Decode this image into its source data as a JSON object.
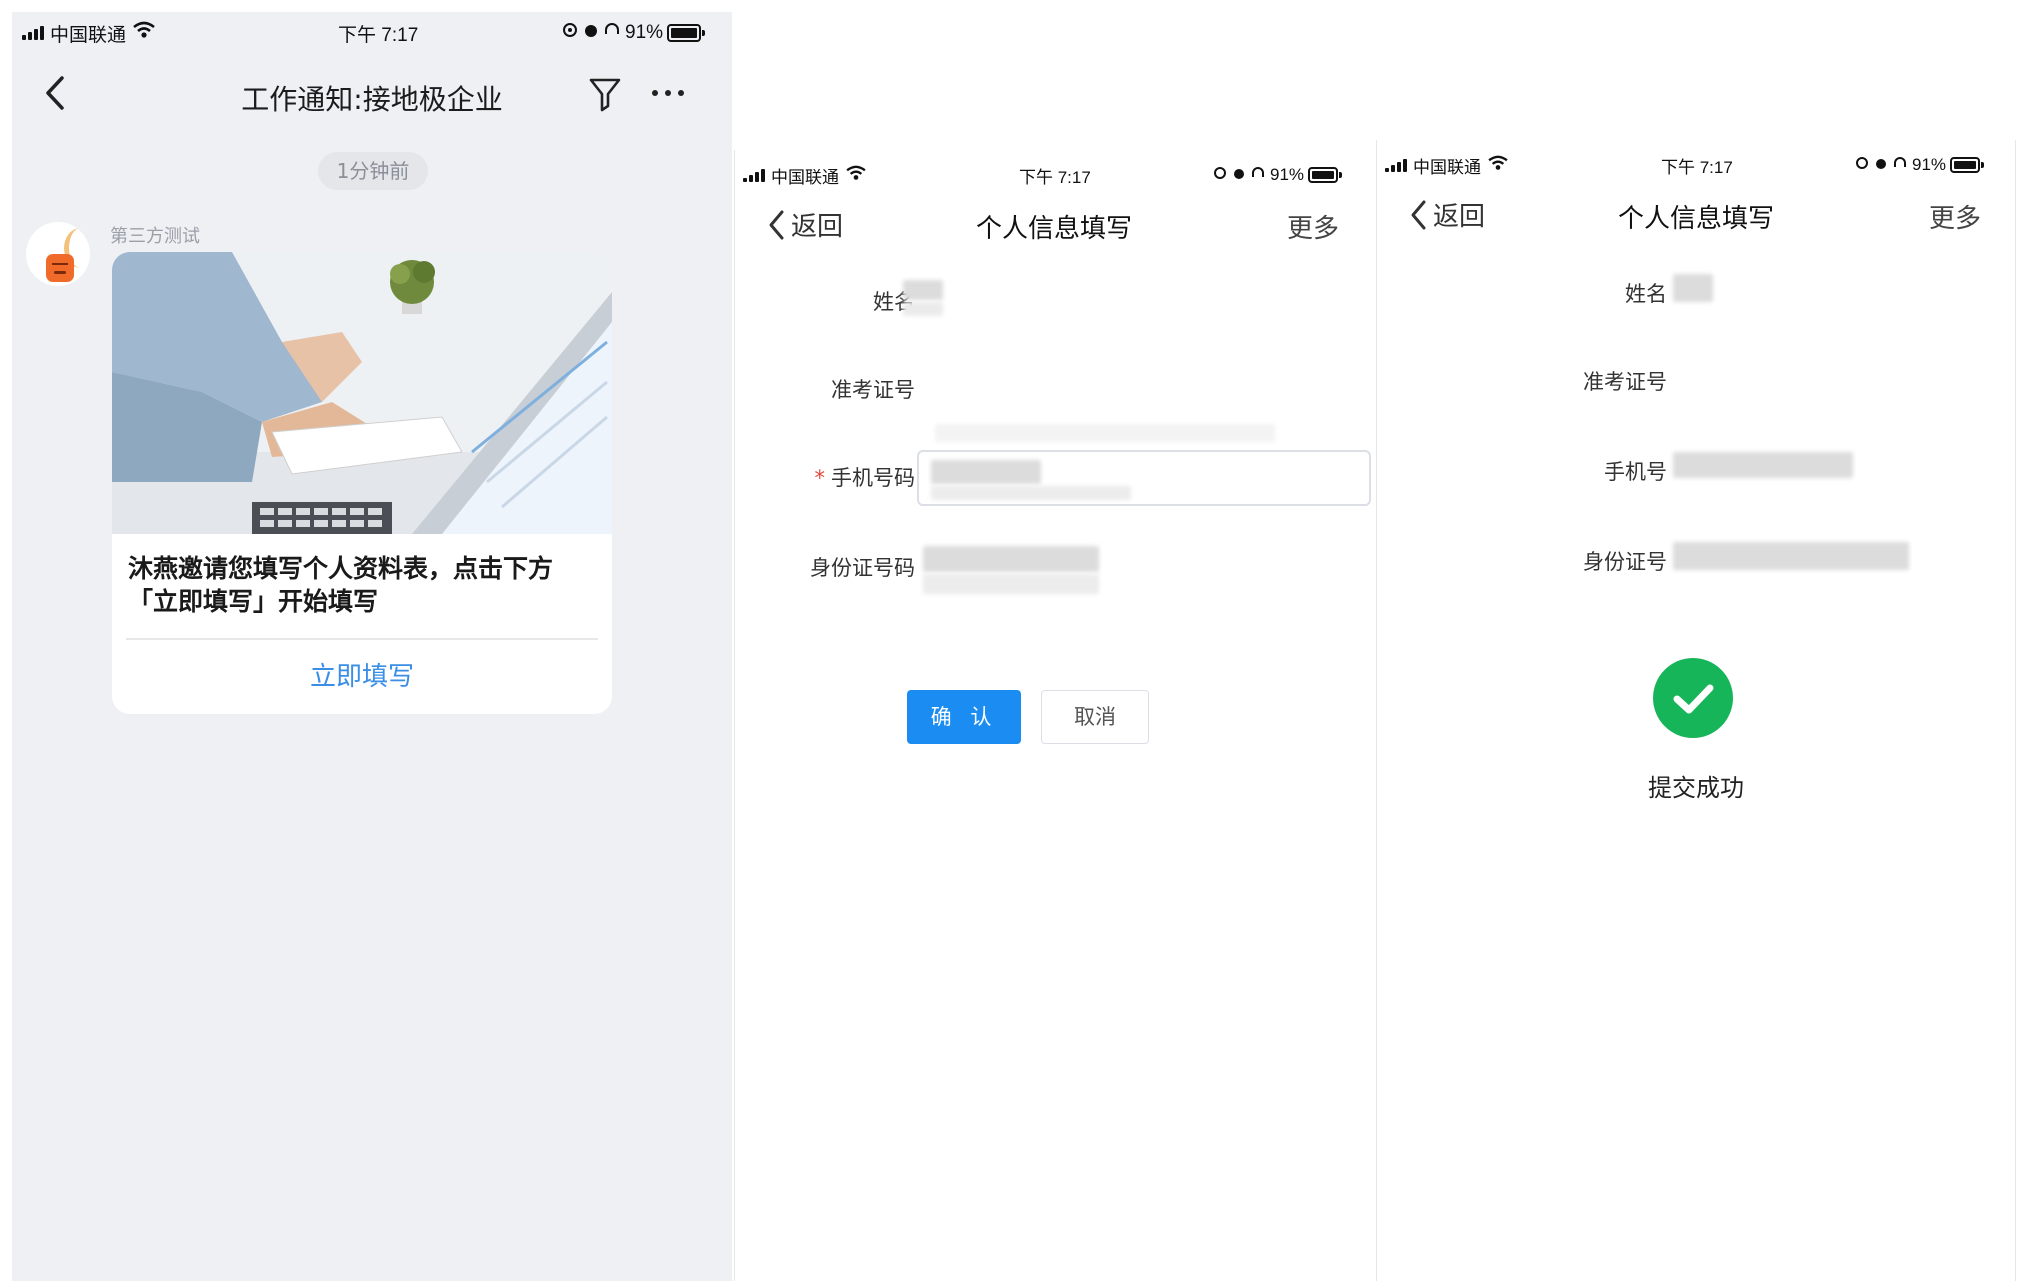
{
  "chat": {
    "status": {
      "carrier": "中国联通",
      "time": "下午 7:17",
      "battery": "91%"
    },
    "title": "工作通知:接地极企业",
    "time_pill": "1分钟前",
    "sender": "第三方测试",
    "card_text": "沐燕邀请您填写个人资料表，点击下方「立即填写」开始填写",
    "card_button": "立即填写"
  },
  "form": {
    "status": {
      "carrier": "中国联通",
      "time": "下午 7:17",
      "battery": "91%"
    },
    "back": "返回",
    "title": "个人信息填写",
    "more": "更多",
    "fields": [
      {
        "label": "姓名"
      },
      {
        "label": "准考证号"
      },
      {
        "label": "手机号码",
        "required_mark": "*"
      },
      {
        "label": "身份证号码"
      }
    ],
    "confirm": "确 认",
    "cancel": "取消"
  },
  "success": {
    "status": {
      "carrier": "中国联通",
      "time": "下午 7:17",
      "battery": "91%"
    },
    "back": "返回",
    "title": "个人信息填写",
    "more": "更多",
    "fields": [
      {
        "label": "姓名"
      },
      {
        "label": "准考证号"
      },
      {
        "label": "手机号"
      },
      {
        "label": "身份证号"
      }
    ],
    "message": "提交成功",
    "icon": "check-circle-icon",
    "icon_color": "#17b559"
  },
  "colors": {
    "accent": "#1b8cf2",
    "link": "#3a8ee6",
    "required": "#e0483e"
  }
}
